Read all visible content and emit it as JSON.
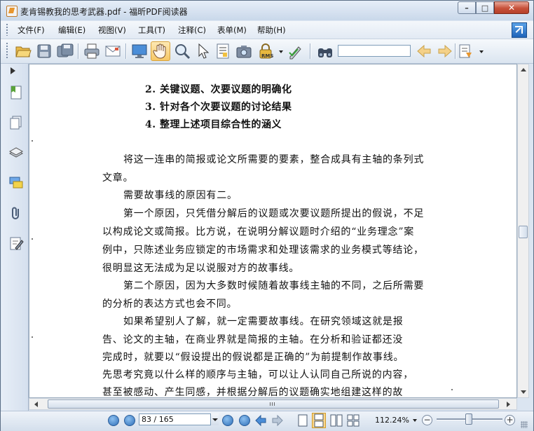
{
  "window": {
    "title": "麦肯锡教我的思考武器.pdf - 福昕PDF阅读器",
    "controls": {
      "minimize": "–",
      "maximize": "□",
      "close": "✕"
    }
  },
  "menu": {
    "items": [
      {
        "label": "文件(F)"
      },
      {
        "label": "编辑(E)"
      },
      {
        "label": "视图(V)"
      },
      {
        "label": "工具(T)"
      },
      {
        "label": "注释(C)"
      },
      {
        "label": "表单(M)"
      },
      {
        "label": "帮助(H)"
      }
    ]
  },
  "toolbar": {
    "icons": [
      "open-folder-icon",
      "save-icon",
      "save-as-icon",
      "print-icon",
      "email-icon",
      "fullscreen-icon",
      "hand-tool-icon",
      "zoom-tool-icon",
      "select-arrow-icon",
      "text-select-icon",
      "snapshot-icon",
      "rms-lock-icon",
      "sign-icon",
      "find-binoculars-icon",
      "search-prev-icon",
      "search-next-icon",
      "highlight-icon"
    ],
    "rms_label": "RMS",
    "search_value": ""
  },
  "left_panel": {
    "icons": [
      "bookmarks-icon",
      "pages-icon",
      "layers-icon",
      "comments-icon",
      "attachments-icon",
      "signatures-icon"
    ]
  },
  "document": {
    "lines": [
      "2. 关键议题、次要议题的明确化",
      "3. 针对各个次要议题的讨论结果",
      "4. 整理上述项目综合性的涵义",
      "将这一连串的简报或论文所需要的要素，整合成具有主轴的条列式",
      "文章。",
      "需要故事线的原因有二。",
      "第一个原因，只凭借分解后的议题或次要议题所提出的假说，不足",
      "以构成论文或简报。比方说，在说明分解议题时介绍的“业务理念”案",
      "例中，只陈述业务应锁定的市场需求和处理该需求的业务模式等结论，",
      "很明显这无法成为足以说服对方的故事线。",
      "第二个原因，因为大多数时候随着故事线主轴的不同，之后所需要",
      "的分析的表达方式也会不同。",
      "如果希望别人了解，就一定需要故事线。在研究领域这就是报",
      "告、论文的主轴，在商业界就是简报的主轴。在分析和验证都还没",
      "完成时，就要以“假设提出的假说都是正确的”为前提制作故事线。",
      "先思考究竟以什么样的顺序与主轴，可以让人认同自己所说的内容，",
      "甚至被感动、产生同感，并根据分解后的议题确实地组建这样的故"
    ]
  },
  "status": {
    "page_value": "83 / 165",
    "zoom": "112.24%",
    "zoom_level_percent": 48,
    "zoom_out": "−",
    "zoom_in": "+"
  }
}
